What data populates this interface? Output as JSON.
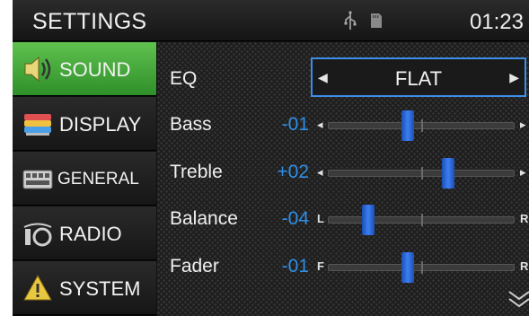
{
  "header": {
    "title": "SETTINGS",
    "time": "01:23",
    "icons": [
      "usb-icon",
      "sd-card-icon"
    ]
  },
  "sidebar": {
    "items": [
      {
        "label": "SOUND",
        "icon": "speaker-icon",
        "active": true
      },
      {
        "label": "DISPLAY",
        "icon": "display-icon",
        "active": false
      },
      {
        "label": "GENERAL",
        "icon": "keyboard-icon",
        "active": false
      },
      {
        "label": "RADIO",
        "icon": "radio-icon",
        "active": false
      },
      {
        "label": "SYSTEM",
        "icon": "warning-icon",
        "active": false
      }
    ]
  },
  "sound": {
    "eq": {
      "label": "EQ",
      "value": "FLAT"
    },
    "sliders": [
      {
        "label": "Bass",
        "value": "-01",
        "level": -1,
        "min": -7,
        "max": 7,
        "left_end": "◂",
        "right_end": "▸"
      },
      {
        "label": "Treble",
        "value": "+02",
        "level": 2,
        "min": -7,
        "max": 7,
        "left_end": "◂",
        "right_end": "▸"
      },
      {
        "label": "Balance",
        "value": "-04",
        "level": -4,
        "min": -7,
        "max": 7,
        "left_end": "L",
        "right_end": "R"
      },
      {
        "label": "Fader",
        "value": "-01",
        "level": -1,
        "min": -7,
        "max": 7,
        "left_end": "F",
        "right_end": "R"
      }
    ]
  },
  "colors": {
    "accent": "#2f8fe6",
    "active_tab": "#4caf3f",
    "knob": "#2f6fe0"
  }
}
